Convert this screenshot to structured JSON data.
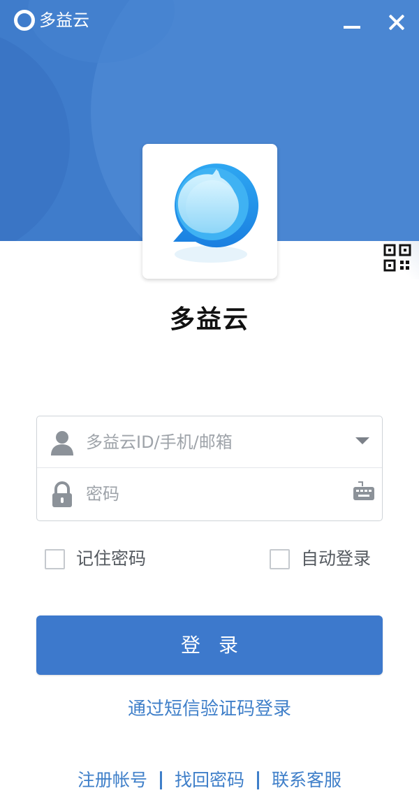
{
  "window": {
    "app_name": "多益云",
    "minimize_icon": "minimize-icon",
    "close_icon": "close-icon"
  },
  "logo": {
    "icon": "chat-bubble-logo",
    "title": "多益云"
  },
  "qr_login": {
    "icon": "qr-code-icon"
  },
  "form": {
    "account_placeholder": "多益云ID/手机/邮箱",
    "password_placeholder": "密码",
    "account_icon": "user-icon",
    "password_icon": "lock-icon",
    "dropdown_icon": "chevron-down-icon",
    "keyboard_icon": "keyboard-icon"
  },
  "options": {
    "remember_password": "记住密码",
    "auto_login": "自动登录",
    "remember_checked": false,
    "auto_checked": false
  },
  "login_button": "登录",
  "sms_login_link": "通过短信验证码登录",
  "footer": {
    "register": "注册帐号",
    "recover": "找回密码",
    "support": "联系客服"
  },
  "colors": {
    "header_blue": "#3f7ccb",
    "button_blue": "#3d79cc",
    "link_blue": "#3f7fc9",
    "placeholder_gray": "#9ea3a9"
  }
}
